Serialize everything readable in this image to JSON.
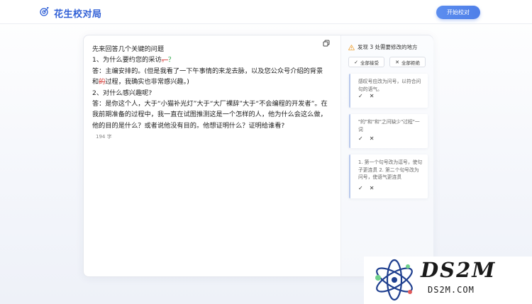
{
  "header": {
    "app_title": "花生校对局",
    "start_button": "开始校对"
  },
  "editor": {
    "lines": [
      {
        "text": "先来回答几个关键的问题"
      },
      {
        "pre": "1、为什么要约您的采访",
        "del": "。",
        "ins": "？"
      },
      {
        "text": "答：主编安排的。(但是我看了一下午事情的来龙去脉，以及您公众号介绍的背景"
      },
      {
        "pre": "和",
        "del": "的",
        "post": "过程，我确实也非常感兴趣。)"
      },
      {
        "text": "2、对什么感兴趣呢?"
      },
      {
        "text": "答：是你这个人，大于“小猫补光灯”大于“大厂裸辞”大于“不会编程的开发者”。在"
      },
      {
        "text": "我前期准备的过程中，我一直在试图推测这是一个怎样的人，他为什么会这么做，"
      },
      {
        "text": "他的目的是什么？或者说他没有目的。他想证明什么？证明给谁看?"
      }
    ],
    "word_count": "194 字"
  },
  "panel": {
    "summary": "发现 3 处需要修改的地方",
    "accept_all": "全部接受",
    "reject_all": "全部拒绝",
    "accept_symbol": "✓",
    "reject_symbol": "✕",
    "suggestions": [
      {
        "text": "感叹号应改为问号，以符合问句的语气。"
      },
      {
        "text": "\"的\"和\"和\"之间缺少\"过程\"一词"
      },
      {
        "text": "1. 第一个句号改为逗号，使句子更连贯 2. 第二个句号改为问号，使语气更连贯"
      }
    ]
  },
  "watermark": {
    "big": "DS2M",
    "small": "DS2M.COM"
  },
  "colors": {
    "brand": "#2f5fd6",
    "button": "#4f7fe8",
    "deletion": "#d9534f",
    "insertion": "#28a745",
    "warning": "#f0ad4e"
  }
}
